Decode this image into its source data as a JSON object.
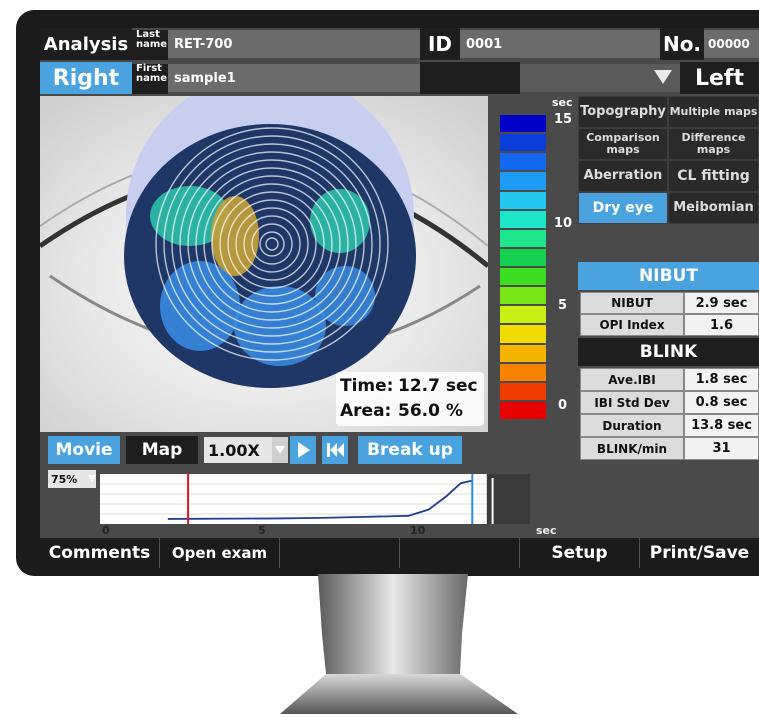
{
  "header": {
    "analysis_label": "Analysis",
    "last_name_label": "Last\nname",
    "last_name_value": "RET-700",
    "id_label": "ID",
    "id_value": "0001",
    "no_label": "No.",
    "no_value": "00000",
    "right_label": "Right",
    "first_name_label": "First\nname",
    "first_name_value": "sample1",
    "left_label": "Left"
  },
  "image": {
    "time_label": "Time:",
    "time_value": "12.7 sec",
    "area_label": "Area:",
    "area_value": "56.0 %"
  },
  "color_scale": {
    "unit": "sec",
    "ticks": [
      "15",
      "10",
      "5",
      "0"
    ],
    "colors": [
      "#0000c8",
      "#0a3ddc",
      "#1468f0",
      "#1e9bf5",
      "#23c8f0",
      "#1ee6c8",
      "#1ee68c",
      "#14d250",
      "#3cdc1e",
      "#78e614",
      "#c8f014",
      "#f0dc00",
      "#f5b400",
      "#f58200",
      "#f03c00",
      "#e60000"
    ]
  },
  "menu": {
    "topography": "Topography",
    "multiple_maps": "Multiple maps",
    "comparison_maps": "Comparison maps",
    "difference_maps": "Difference maps",
    "aberration": "Aberration",
    "cl_fitting": "CL fitting",
    "dry_eye": "Dry eye",
    "meibomian": "Meibomian"
  },
  "nibut": {
    "header": "NIBUT",
    "rows": [
      {
        "label": "NIBUT",
        "value": "2.9 sec"
      },
      {
        "label": "OPI Index",
        "value": "1.6"
      }
    ]
  },
  "blink": {
    "header": "BLINK",
    "rows": [
      {
        "label": "Ave.IBI",
        "value": "1.8 sec"
      },
      {
        "label": "IBI Std Dev",
        "value": "0.8 sec"
      },
      {
        "label": "Duration",
        "value": "13.8 sec"
      },
      {
        "label": "BLINK/min",
        "value": "31"
      }
    ]
  },
  "controls": {
    "movie": "Movie",
    "map": "Map",
    "speed": "1.00X",
    "break_up": "Break up",
    "percent": "75%"
  },
  "plot": {
    "x_ticks": [
      "0",
      "5",
      "10"
    ],
    "unit": "sec",
    "xlim": [
      0,
      14
    ],
    "red_marker_sec": 2.9,
    "blue_marker_sec": 12.7,
    "curve": [
      [
        2.2,
        0.02
      ],
      [
        6,
        0.03
      ],
      [
        7.5,
        0.04
      ],
      [
        9,
        0.06
      ],
      [
        10.5,
        0.08
      ],
      [
        11.2,
        0.2
      ],
      [
        11.8,
        0.45
      ],
      [
        12.3,
        0.7
      ],
      [
        12.7,
        0.75
      ]
    ]
  },
  "bottom_bar": {
    "comments": "Comments",
    "open_exam": "Open exam",
    "setup": "Setup",
    "print_save": "Print/Save"
  }
}
